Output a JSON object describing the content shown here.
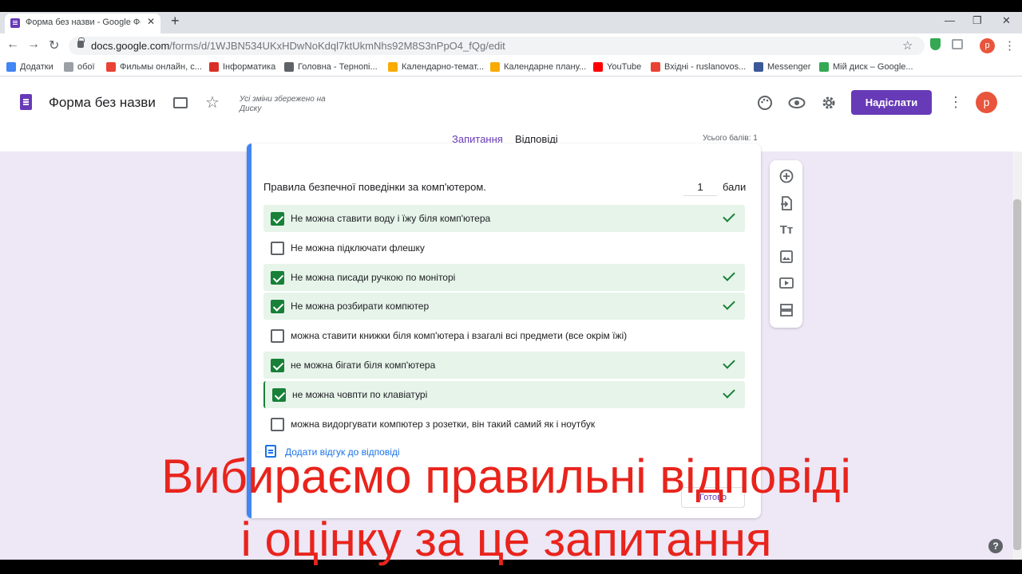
{
  "browser": {
    "tab_title": "Форма без назви - Google Форми",
    "url_host": "docs.google.com",
    "url_path": "/forms/d/1WJBN534UKxHDwNoKdql7ktUkmNhs92M8S3nPpO4_fQg/edit",
    "profile_initial": "р",
    "bookmarks": [
      {
        "label": "Додатки",
        "color": "#4285f4"
      },
      {
        "label": "обої",
        "color": "#9aa0a6"
      },
      {
        "label": "Фильмы онлайн, с...",
        "color": "#ea4335"
      },
      {
        "label": "Інформатика",
        "color": "#d93025"
      },
      {
        "label": "Головна - Тернопі...",
        "color": "#5f6368"
      },
      {
        "label": "Календарно-темат...",
        "color": "#f9ab00"
      },
      {
        "label": "Календарне плану...",
        "color": "#f9ab00"
      },
      {
        "label": "YouTube",
        "color": "#ff0000"
      },
      {
        "label": "Вхідні - ruslanovos...",
        "color": "#ea4335"
      },
      {
        "label": "Messenger",
        "color": "#3b5998"
      },
      {
        "label": "Мій диск – Google...",
        "color": "#34a853"
      }
    ]
  },
  "forms": {
    "title": "Форма без назви",
    "save_status": "Усі зміни збережено на Диску",
    "send_label": "Надіслати",
    "account_initial": "р",
    "tabs": {
      "questions": "Запитання",
      "responses": "Відповіді"
    },
    "total_points": "Усього балів: 1",
    "accent_color": "#673ab7"
  },
  "question": {
    "text": "Правила безпечної поведінки за комп'ютером.",
    "points": "1",
    "points_unit": "бали",
    "options": [
      {
        "label": "Не можна ставити воду і їжу біля комп'ютера",
        "correct": true
      },
      {
        "label": "Не можна підключати флешку",
        "correct": false
      },
      {
        "label": "Не можна писади ручкою по моніторі",
        "correct": true
      },
      {
        "label": "Не можна розбирати компютер",
        "correct": true
      },
      {
        "label": "можна ставити книжки біля комп'ютера і взагалі всі предмети (все окрім їжі)",
        "correct": false
      },
      {
        "label": "не можна бігати біля комп'ютера",
        "correct": true
      },
      {
        "label": "не можна човпти по клавіатурі",
        "correct": true
      },
      {
        "label": "можна видоргувати компютер з розетки, він такий самий як і ноутбук",
        "correct": false
      }
    ],
    "feedback_link": "Додати відгук до відповіді",
    "done_label": "Готово"
  },
  "caption": {
    "line1": "Вибираємо правильні відповіді",
    "line2": "і оцінку за це запитання"
  }
}
